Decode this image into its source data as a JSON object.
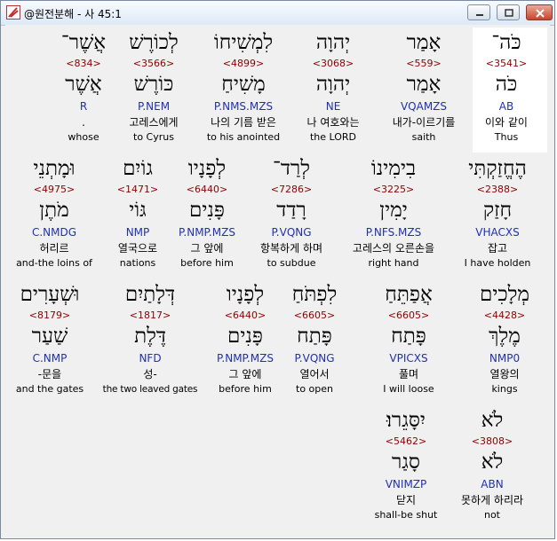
{
  "window": {
    "title": "@원전분해 - 사 45:1"
  },
  "words": [
    {
      "heb": "אֲשֶׁר־",
      "strong": "<834>",
      "lemma": "אֲשֶׁר",
      "morph": "R",
      "kor": ".",
      "eng": "whose"
    },
    {
      "heb": "לְכוֹרֶשׁ",
      "strong": "<3566>",
      "lemma": "כּוֹרֶשׁ",
      "morph": "P.NEM",
      "kor": "고레스에게",
      "eng": "to Cyrus"
    },
    {
      "heb": "לִמְשִׁיחוֹ",
      "strong": "<4899>",
      "lemma": "מָשִׁיחַ",
      "morph": "P.NMS.MZS",
      "kor": "나의 기름 받은",
      "eng": "to his anointed"
    },
    {
      "heb": "יְהוָה",
      "strong": "<3068>",
      "lemma": "יְהוָה",
      "morph": "NE",
      "kor": "나 여호와는",
      "eng": "the LORD"
    },
    {
      "heb": "אָמַר",
      "strong": "<559>",
      "lemma": "אָמַר",
      "morph": "VQAMZS",
      "kor": "내가-이르기를",
      "eng": "saith"
    },
    {
      "heb": "כֹּה־",
      "strong": "<3541>",
      "lemma": "כֹּה",
      "morph": "AB",
      "kor": "이와 같이",
      "eng": "Thus"
    },
    {
      "heb": "וּמָתְנֵי",
      "strong": "<4975>",
      "lemma": "מֹתֶן",
      "morph": "C.NMDG",
      "kor": "허리르",
      "eng": "and-the loins of"
    },
    {
      "heb": "גוֹיִם",
      "strong": "<1471>",
      "lemma": "גּוֹי",
      "morph": "NMP",
      "kor": "열국으로",
      "eng": "nations"
    },
    {
      "heb": "לְפָנָיו",
      "strong": "<6440>",
      "lemma": "פָּנִים",
      "morph": "P.NMP.MZS",
      "kor": "그 앞에",
      "eng": "before him"
    },
    {
      "heb": "לְרַד־",
      "strong": "<7286>",
      "lemma": "רָדַד",
      "morph": "P.VQNG",
      "kor": "항복하게 하며",
      "eng": "to subdue"
    },
    {
      "heb": "בִימִינוֹ",
      "strong": "<3225>",
      "lemma": "יָמִין",
      "morph": "P.NFS.MZS",
      "kor": "고레스의 오른손을",
      "eng": "right hand"
    },
    {
      "heb": "הֶחֱזַקְתִּי",
      "strong": "<2388>",
      "lemma": "חָזַק",
      "morph": "VHACXS",
      "kor": "잡고",
      "eng": "I have holden"
    },
    {
      "heb": "וּשְׁעָרִים",
      "strong": "<8179>",
      "lemma": "שַׁעַר",
      "morph": "C.NMP",
      "kor": "-문을",
      "eng": "and the gates"
    },
    {
      "heb": "דְּלָתַיִם",
      "strong": "<1817>",
      "lemma": "דֶּלֶת",
      "morph": "NFD",
      "kor": "성-",
      "eng": "the two leaved gates"
    },
    {
      "heb": "לְפָנָיו",
      "strong": "<6440>",
      "lemma": "פָּנִים",
      "morph": "P.NMP.MZS",
      "kor": "그 앞에",
      "eng": "before him"
    },
    {
      "heb": "לִפְתֹּחַ",
      "strong": "<6605>",
      "lemma": "פָּתַח",
      "morph": "P.VQNG",
      "kor": "열어서",
      "eng": "to open"
    },
    {
      "heb": "אֲפַתֵּחַ",
      "strong": "<6605>",
      "lemma": "פָּתַח",
      "morph": "VPICXS",
      "kor": "풀며",
      "eng": "I will loose"
    },
    {
      "heb": "מְלָכִים",
      "strong": "<4428>",
      "lemma": "מֶלֶךְ",
      "morph": "NMP0",
      "kor": "열왕의",
      "eng": "kings"
    },
    {
      "heb": "יִסָּגֵרוּ׃",
      "strong": "<5462>",
      "lemma": "סָגַר",
      "morph": "VNIMZP",
      "kor": "닫지",
      "eng": "shall-be shut"
    },
    {
      "heb": "לֹא",
      "strong": "<3808>",
      "lemma": "לֹא",
      "morph": "ABN",
      "kor": "못하게 하리라",
      "eng": "not"
    }
  ]
}
